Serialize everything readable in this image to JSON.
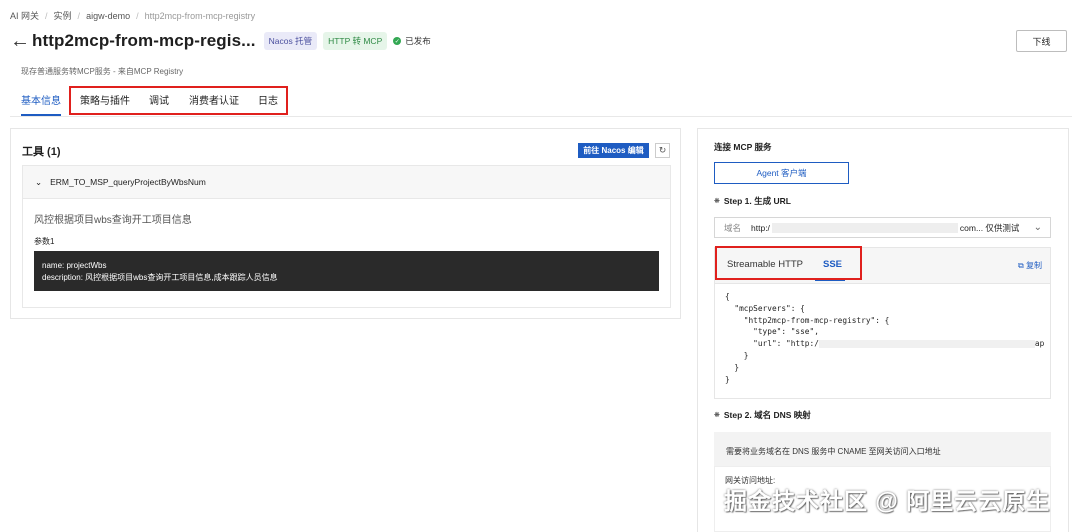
{
  "breadcrumb": [
    "AI 网关",
    "实例",
    "aigw-demo",
    "http2mcp-from-mcp-registry"
  ],
  "header": {
    "back_icon": "←",
    "title": "http2mcp-from-mcp-regis...",
    "tag_nacos": "Nacos 托管",
    "tag_http": "HTTP 转 MCP",
    "status": "已发布",
    "download": "下线"
  },
  "subtitle": "现存普通服务转MCP服务 - 来自MCP Registry",
  "tabs": [
    "基本信息",
    "策略与插件",
    "调试",
    "消费者认证",
    "日志"
  ],
  "tools": {
    "title": "工具 (1)",
    "nacos_button": "前往 Nacos 编辑",
    "refresh_icon": "↻",
    "tool_name": "ERM_TO_MSP_queryProjectByWbsNum",
    "tool_desc": "风控根据项目wbs查询开工项目信息",
    "params_label": "参数1",
    "param_name": "name: projectWbs",
    "param_desc": "description: 风控根据项目wbs查询开工项目信息,成本跟踪人员信息"
  },
  "connect": {
    "title": "连接 MCP 服务",
    "agent_button": "Agent 客户端",
    "step1": "Step 1. 生成 URL",
    "domain_label": "域名",
    "domain_prefix": "http:/",
    "domain_suffix": "com... 仅供测试",
    "code_tabs": [
      "Streamable HTTP",
      "SSE"
    ],
    "copy": "复制",
    "code_lines": [
      "{",
      "  \"mcpServers\": {",
      "    \"http2mcp-from-mcp-registry\": {",
      "      \"type\": \"sse\",",
      "      \"url\": \"http:/",
      "    }",
      "  }",
      "}"
    ],
    "url_tail": "ap",
    "step2": "Step 2. 域名 DNS 映射",
    "dns_text": "需要将业务域名在 DNS 服务中 CNAME 至网关访问入口地址",
    "gateway_addr_label": "网关访问地址:"
  },
  "watermark": "掘金技术社区 @ 阿里云云原生"
}
